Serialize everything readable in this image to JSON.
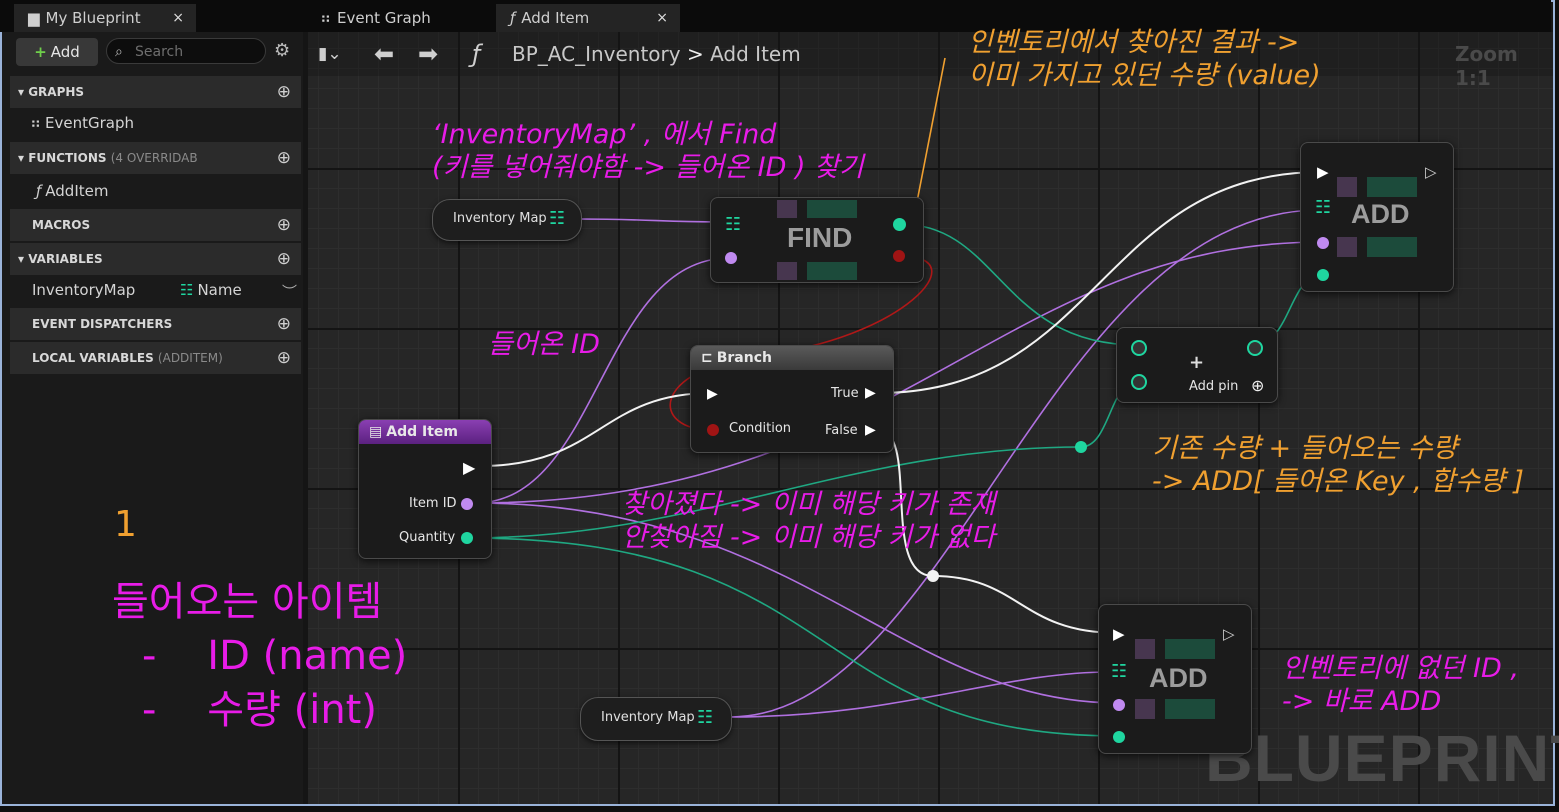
{
  "tabs": {
    "my_blueprint": "My Blueprint",
    "event_graph": "Event Graph",
    "add_item": "Add Item",
    "close": "×"
  },
  "left_panel": {
    "add_button": "Add",
    "search_placeholder": "Search",
    "sections": {
      "graphs": "GRAPHS",
      "functions": "FUNCTIONS",
      "functions_note": "(4 OVERRIDAB",
      "macros": "MACROS",
      "variables": "VARIABLES",
      "event_dispatchers": "EVENT DISPATCHERS",
      "local_variables": "LOCAL VARIABLES",
      "local_variables_note": "(ADDITEM)"
    },
    "items": {
      "event_graph": "EventGraph",
      "add_item_fn": "AddItem",
      "variable_name": "InventoryMap",
      "variable_type": "Name"
    }
  },
  "graph_toolbar": {
    "breadcrumb_blueprint": "BP_AC_Inventory",
    "breadcrumb_sep": ">",
    "breadcrumb_function": "Add Item",
    "zoom": "Zoom 1:1"
  },
  "nodes": {
    "inventory_map_top": "Inventory Map",
    "find": "FIND",
    "branch_title": "Branch",
    "branch_true": "True",
    "branch_false": "False",
    "branch_condition": "Condition",
    "add_item_title": "Add Item",
    "item_id": "Item ID",
    "quantity": "Quantity",
    "add_pin": "Add pin",
    "add_top": "ADD",
    "add_bottom": "ADD",
    "inventory_map_bottom": "Inventory Map"
  },
  "watermark": "BLUEPRINT",
  "annotations": {
    "find_result": "인벤토리에서 찾아진 결과 ->\n이미 가지고 있던 수량 (value)",
    "find_desc": "‘InventoryMap’ , 에서 Find\n(키를 넣어줘야함 -> 들어온 ID ) 찾기",
    "incoming_id": "들어온 ID",
    "sum_desc": "기존 수량 + 들어오는 수량\n-> ADD[ 들어온 Key , 합수량 ]",
    "found_desc": "찾아졌다 -> 이미 해당 키가 존재\n안찾아짐 -> 이미 해당 키가 없다",
    "not_found_desc": "인벤토리에 없던 ID ,\n-> 바로 ADD",
    "number": "1",
    "incoming_item": "들어오는 아이템",
    "bullet_id": "-    ID (name)",
    "bullet_qty": "-    수량 (int)"
  },
  "colors": {
    "annotation_magenta": "#e81ce8",
    "annotation_orange": "#f0a030",
    "pin_teal": "#1fd6a0",
    "pin_purple": "#b070e0",
    "exec_white": "#ffffff"
  }
}
